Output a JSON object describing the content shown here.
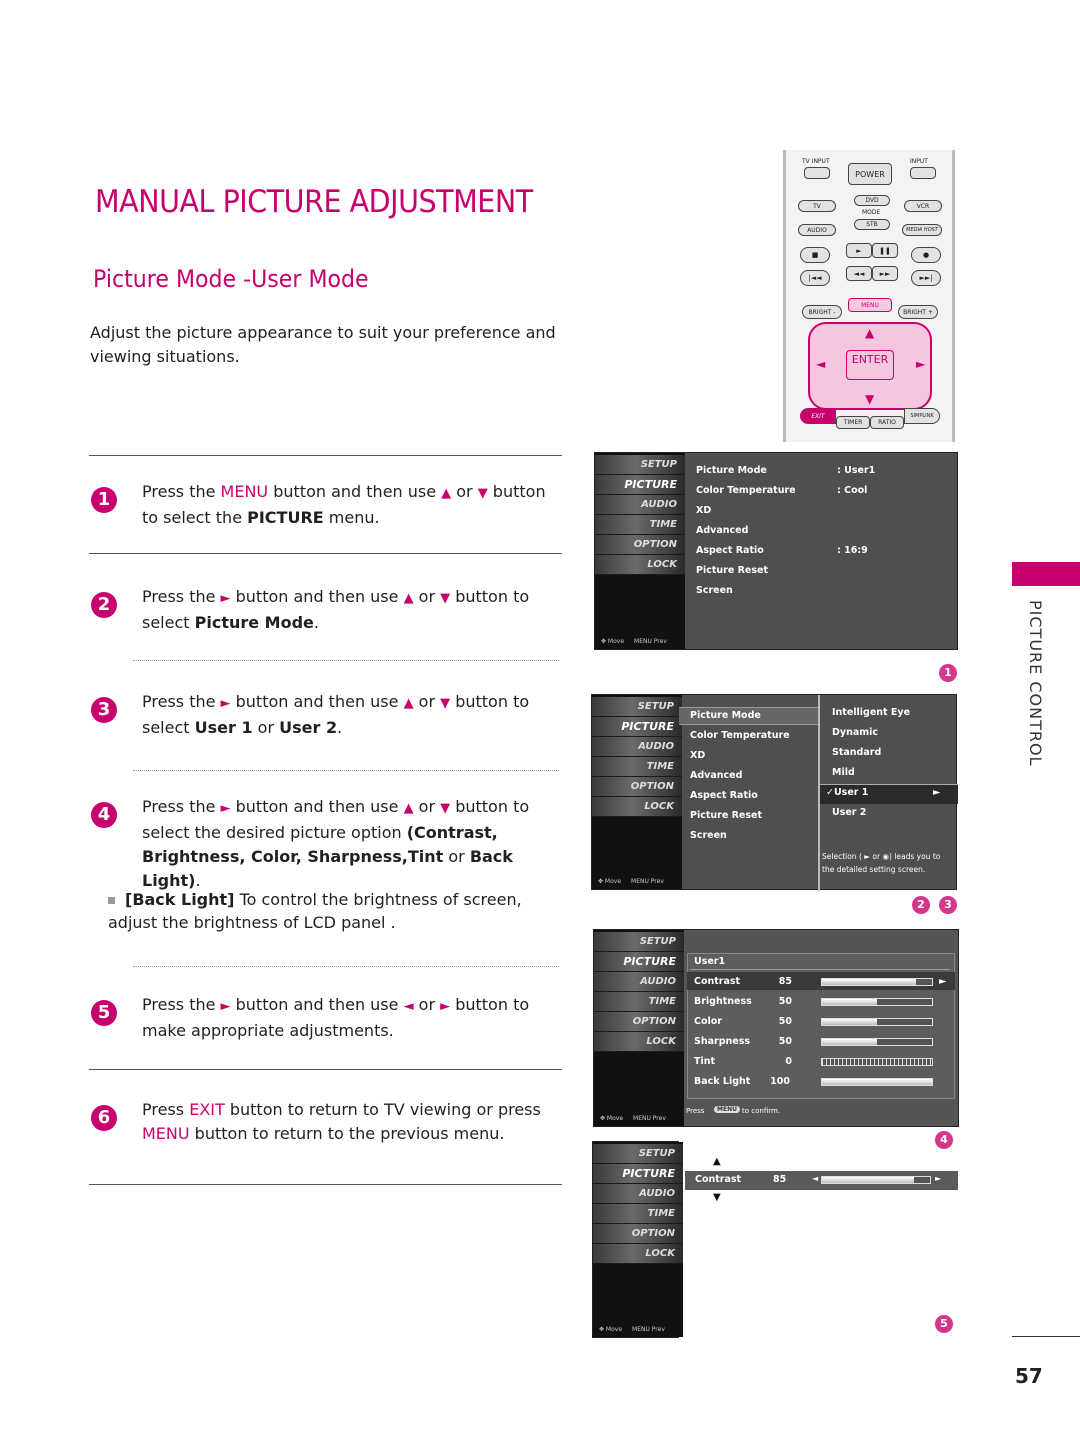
{
  "page": {
    "title": "MANUAL PICTURE ADJUSTMENT",
    "subtitle": "Picture Mode -User Mode",
    "intro": "Adjust the picture appearance to suit your preference and viewing situations.",
    "section_tab": "PICTURE CONTROL",
    "page_number": "57",
    "accent_color": "#c8006e"
  },
  "steps": [
    {
      "num": "1",
      "parts": [
        "Press the ",
        "MENU",
        " button and then use ",
        "▲",
        " or ",
        "▼",
        " button to select the ",
        "PICTURE",
        " menu."
      ]
    },
    {
      "num": "2",
      "parts": [
        "Press the ",
        "►",
        " button and then use ",
        "▲",
        " or ",
        "▼",
        " button to select ",
        "Picture Mode",
        "."
      ]
    },
    {
      "num": "3",
      "parts": [
        "Press the ",
        "►",
        " button and then use ",
        "▲",
        " or ",
        "▼",
        " button to select ",
        "User 1",
        " or ",
        "User 2",
        "."
      ]
    },
    {
      "num": "4",
      "parts": [
        "Press the ",
        "►",
        " button and then use ",
        "▲",
        " or ",
        "▼",
        " button to select the desired picture option ",
        "(Contrast, Brightness, Color, Sharpness,Tint",
        " or ",
        "Back Light)",
        "."
      ]
    },
    {
      "num": "5",
      "parts": [
        "Press the ",
        "►",
        " button and then use ",
        "◄",
        " or ",
        "►",
        " button to make appropriate adjustments."
      ]
    },
    {
      "num": "6",
      "parts": [
        "Press ",
        "EXIT",
        " button to return to TV viewing or press ",
        "MENU",
        " button to return to the previous menu."
      ]
    }
  ],
  "note": {
    "label": "[Back Light]",
    "text": " To control the brightness of screen, adjust the brightness of  LCD panel ."
  },
  "remote": {
    "tv_input": "TV INPUT",
    "power": "POWER",
    "input": "INPUT",
    "tv": "TV",
    "dvd": "DVD",
    "vcr": "VCR",
    "mode": "MODE",
    "audio": "AUDIO",
    "stb": "STB",
    "media_host": "MEDIA HOST",
    "stop": "■",
    "play": "►",
    "pause": "❚❚",
    "rec": "●",
    "skip_back": "|◄◄",
    "rew": "◄◄",
    "ff": "►►",
    "skip_fwd": "►►|",
    "bright_minus": "BRIGHT -",
    "menu": "MENU",
    "bright_plus": "BRIGHT +",
    "up": "▲",
    "down": "▼",
    "left": "◄",
    "right": "►",
    "enter": "ENTER",
    "exit": "EXIT",
    "timer": "TIMER",
    "ratio": "RATIO",
    "simplink": "SIMPLINK"
  },
  "osd_sidebar": {
    "items": [
      "SETUP",
      "PICTURE",
      "AUDIO",
      "TIME",
      "OPTION",
      "LOCK"
    ],
    "move": "✥ Move",
    "prev": "MENU Prev"
  },
  "screen1": {
    "rows": [
      {
        "label": "Picture Mode",
        "value": ": User1"
      },
      {
        "label": "Color Temperature",
        "value": ": Cool"
      },
      {
        "label": "XD",
        "value": ""
      },
      {
        "label": "Advanced",
        "value": ""
      },
      {
        "label": "Aspect Ratio",
        "value": ": 16:9"
      },
      {
        "label": "Picture Reset",
        "value": ""
      },
      {
        "label": "Screen",
        "value": ""
      }
    ],
    "badge": "1"
  },
  "screen2": {
    "rows": [
      "Picture Mode",
      "Color Temperature",
      "XD",
      "Advanced",
      "Aspect Ratio",
      "Picture Reset",
      "Screen"
    ],
    "options": [
      "Intelligent Eye",
      "Dynamic",
      "Standard",
      "Mild",
      "✓User 1",
      "User 2"
    ],
    "selected_arrow": "►",
    "hint": "Selection ( ► or ◉) leads you to the detailed setting screen.",
    "badges": [
      "2",
      "3"
    ]
  },
  "screen3": {
    "heading": "User1",
    "rows": [
      {
        "label": "Contrast",
        "value": "85",
        "fraction": 0.85
      },
      {
        "label": "Brightness",
        "value": "50",
        "fraction": 0.5
      },
      {
        "label": "Color",
        "value": "50",
        "fraction": 0.5
      },
      {
        "label": "Sharpness",
        "value": "50",
        "fraction": 0.5
      },
      {
        "label": "Tint",
        "value": "0",
        "fraction": 0.5
      },
      {
        "label": "Back Light",
        "value": "100",
        "fraction": 1.0
      }
    ],
    "arrow": "►",
    "confirm_pre": "Press",
    "confirm_key": "MENU",
    "confirm_post": "to confirm.",
    "badge": "4"
  },
  "screen4": {
    "label": "Contrast",
    "value": "85",
    "fraction": 0.85,
    "up": "▲",
    "down": "▼",
    "left": "◄",
    "right": "►",
    "badge": "5"
  }
}
